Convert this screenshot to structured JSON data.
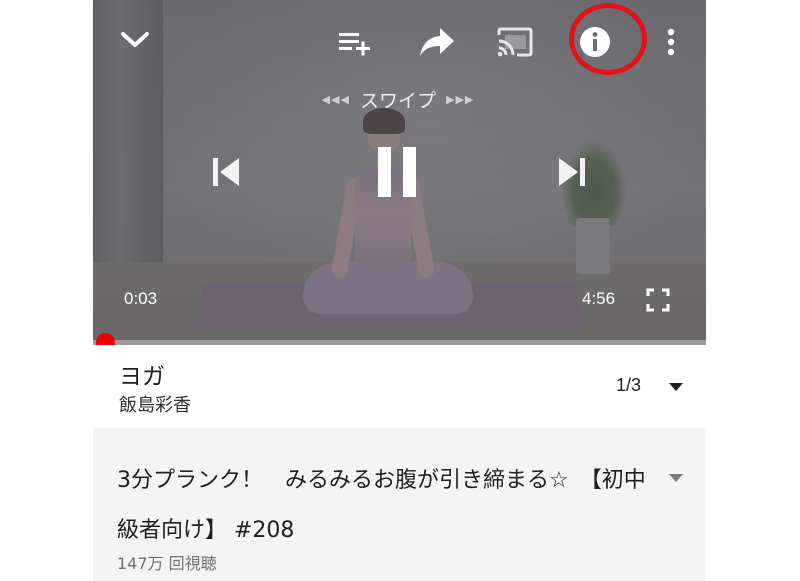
{
  "player": {
    "swipe_label": "スワイプ",
    "swipe_left_arrows": "◀◀◀",
    "swipe_right_arrows": "▶▶▶",
    "current_time": "0:03",
    "duration": "4:56",
    "progress": 0.01,
    "state": "playing",
    "icons": {
      "collapse": "chevron-down-icon",
      "add_to_queue": "playlist-add-icon",
      "share": "share-icon",
      "cast": "cast-icon",
      "info": "info-icon",
      "more": "more-vertical-icon",
      "previous": "skip-previous-icon",
      "pause": "pause-icon",
      "next": "skip-next-icon",
      "fullscreen": "fullscreen-icon"
    },
    "colors": {
      "progress_played": "#ee0000",
      "highlight_ring": "#e0121a"
    }
  },
  "playlist": {
    "title": "ヨガ",
    "channel": "飯島彩香",
    "position": "1/3"
  },
  "video": {
    "title": "3分プランク！　みるみるお腹が引き締まる☆　【初中級者向け】 #208",
    "views": "147万 回視聴"
  }
}
